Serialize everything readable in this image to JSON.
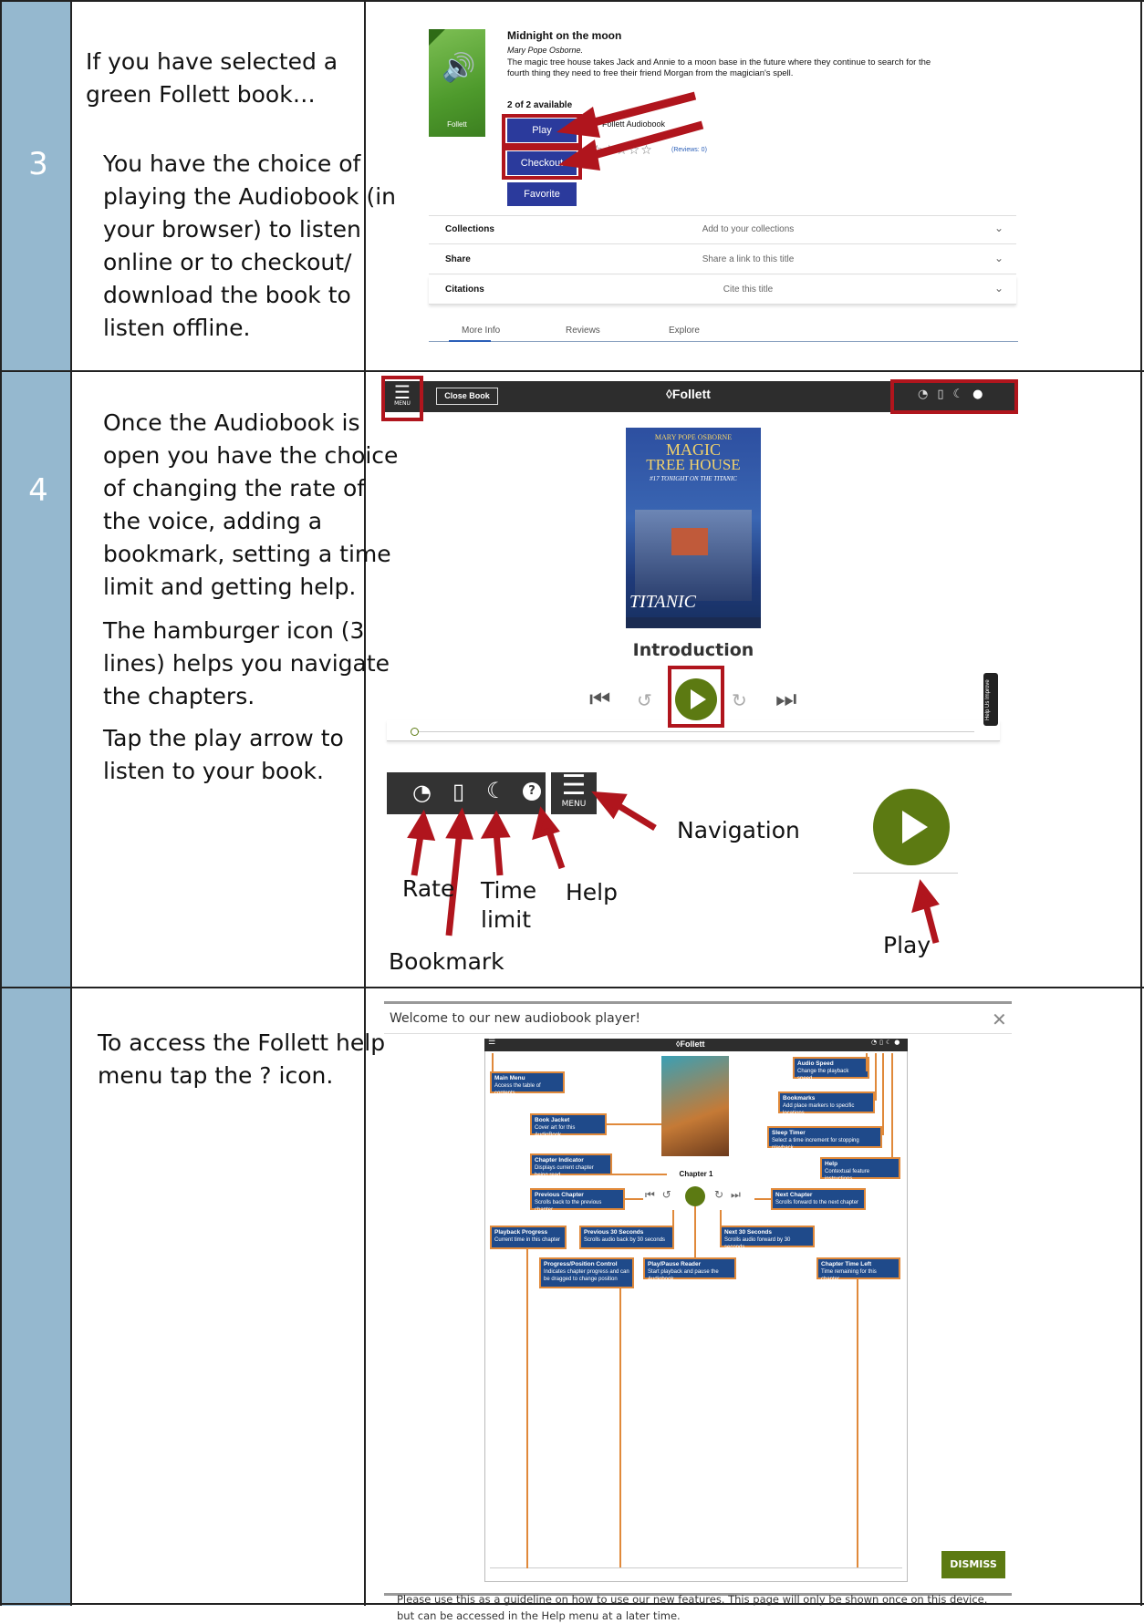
{
  "rows": [
    {
      "number": "3",
      "text_lines": [
        "If you have selected a",
        "green Follett book…"
      ],
      "text2_lines": [
        "You have the choice of",
        "playing the Audiobook (in",
        "your browser) to listen",
        "online or to checkout/",
        "download the book to",
        "listen offline."
      ]
    },
    {
      "number": "4",
      "text_lines": [
        "Once the Audiobook is",
        "open you have the choice",
        "of changing the rate of",
        "the voice, adding a",
        "bookmark, setting a time",
        "limit and getting help."
      ],
      "text2_lines": [
        "The hamburger icon (3",
        "lines) helps you navigate",
        "the chapters."
      ],
      "text3_lines": [
        "Tap the play arrow to",
        "listen to your book."
      ]
    },
    {
      "number": "",
      "text_lines": [
        "To access the Follett help",
        "menu tap the ? icon."
      ]
    }
  ],
  "book_card": {
    "title": "Midnight on the moon",
    "author": "Mary Pope Osborne.",
    "description_lines": [
      "The magic tree house takes Jack and Annie to a moon base in the future where they continue to search for the",
      "fourth thing they need to free their friend Morgan from the magician's spell."
    ],
    "availability": "2 of 2 available",
    "cover_label": "Follett",
    "format": "Follett Audiobook",
    "reviews": "(Reviews: 0)",
    "buttons": {
      "play": "Play",
      "checkout": "Checkout",
      "favorite": "Favorite"
    },
    "accordion": [
      {
        "key": "Collections",
        "value": "Add to your collections"
      },
      {
        "key": "Share",
        "value": "Share a link to this title"
      },
      {
        "key": "Citations",
        "value": "Cite this title"
      }
    ],
    "tabs": [
      "More Info",
      "Reviews",
      "Explore"
    ]
  },
  "player": {
    "close_book": "Close Book",
    "brand": "Follett",
    "menu_label": "MENU",
    "cover_lines": [
      "MARY POPE OSBORNE",
      "MAGIC",
      "TREE HOUSE",
      "#17 TONIGHT ON THE TITANIC",
      "TITANIC"
    ],
    "chapter": "Introduction",
    "side_tab": "Help Us Improve"
  },
  "legend": {
    "menu_label": "MENU",
    "labels": {
      "rate": "Rate",
      "bookmark": "Bookmark",
      "time": "Time",
      "limit": "limit",
      "help": "Help",
      "navigation": "Navigation",
      "play": "Play"
    }
  },
  "help_dialog": {
    "title": "Welcome to our new audiobook player!",
    "brand": "Follett",
    "chapter": "Chapter 1",
    "boxes": [
      {
        "title": "Main Menu",
        "desc": "Access the table of contents"
      },
      {
        "title": "Book Jacket",
        "desc": "Cover art for this AudioBook"
      },
      {
        "title": "Chapter Indicator",
        "desc": "Displays current chapter being read"
      },
      {
        "title": "Previous Chapter",
        "desc": "Scrolls back to the previous chapter"
      },
      {
        "title": "Playback Progress",
        "desc": "Current time in this chapter"
      },
      {
        "title": "Previous 30 Seconds",
        "desc": "Scrolls audio back by 30 seconds"
      },
      {
        "title": "Progress/Position Control",
        "desc": "Indicates chapter progress and can be dragged to change position"
      },
      {
        "title": "Play/Pause Reader",
        "desc": "Start playback and pause the Audiobook"
      },
      {
        "title": "Next 30 Seconds",
        "desc": "Scrolls audio forward by 30 seconds"
      },
      {
        "title": "Next Chapter",
        "desc": "Scrolls forward to the next chapter"
      },
      {
        "title": "Chapter Time Left",
        "desc": "Time remaining for this chapter"
      },
      {
        "title": "Audio Speed",
        "desc": "Change the playback speed"
      },
      {
        "title": "Bookmarks",
        "desc": "Add place markers to specific locations"
      },
      {
        "title": "Sleep Timer",
        "desc": "Select a time increment for stopping playback"
      },
      {
        "title": "Help",
        "desc": "Contextual feature instructions"
      }
    ],
    "footer_lines": [
      "Please use this as a guideline on how to use our new features. This page will only be shown once on this device.",
      "but can be accessed in the Help menu at a later time."
    ],
    "dismiss": "DISMISS"
  },
  "colors": {
    "number_column": "#95b8cf",
    "follett_blue": "#2b3a9c",
    "red_highlight": "#b0151d",
    "play_green": "#5c7a12",
    "box_blue": "#1f4a8a",
    "box_orange": "#e0893a"
  }
}
